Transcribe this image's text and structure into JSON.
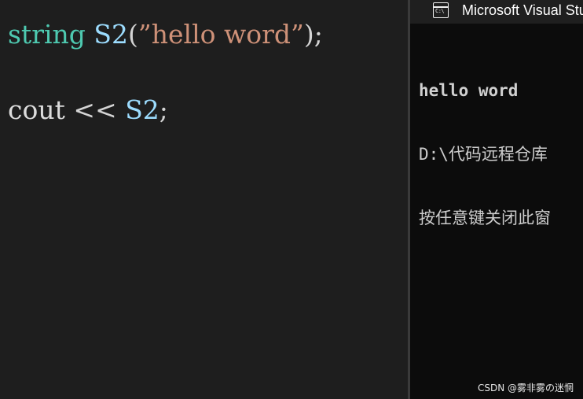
{
  "editor": {
    "line1": {
      "type": "string",
      "var": "S2",
      "open": "(",
      "literal": "”hello word”",
      "close": ");"
    },
    "line2": {
      "object": "cout",
      "op": "<<",
      "var": "S2",
      "end": ";"
    }
  },
  "console": {
    "title": "Microsoft Visual Studio Debug Console",
    "icon_text": "C:\\",
    "lines": [
      "hello word",
      "D:\\代码远程仓库",
      "按任意键关闭此窗"
    ]
  },
  "watermark": "CSDN @雾非雾の迷惘",
  "colors": {
    "editor_bg": "#1e1e1e",
    "console_bg": "#0c0c0c",
    "type": "#4ec9b0",
    "variable": "#9cdcfe",
    "string": "#ce9178"
  }
}
